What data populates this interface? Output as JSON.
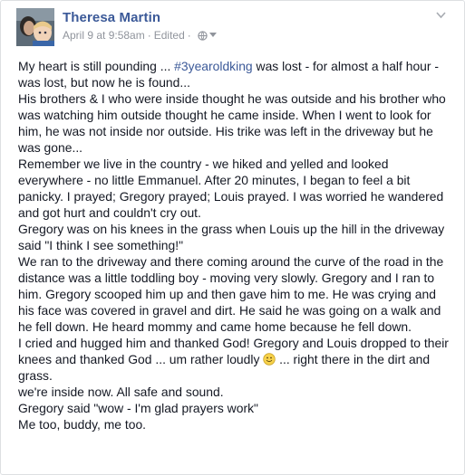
{
  "post": {
    "author_name": "Theresa Martin",
    "timestamp": "April 9 at 9:58am",
    "edited_label": "Edited",
    "separator": "·",
    "privacy_icon": "globe-icon",
    "options_icon": "chevron-down-icon",
    "paragraphs": [
      {
        "before": "My heart is still pounding ... ",
        "hashtag": "#3yearoldking",
        "after": " was lost - for almost a half hour - was lost, but now he is found..."
      },
      {
        "text": "His brothers & I who were inside thought he was outside and his brother who was watching him outside thought he came inside. When I went to look for him, he was not inside nor outside. His trike was left in the driveway but he was gone..."
      },
      {
        "text": "Remember we live in the country - we hiked and yelled and looked everywhere - no little Emmanuel. After 20 minutes, I began to feel a bit panicky. I prayed; Gregory prayed; Louis prayed. I was worried he wandered and got hurt and couldn't cry out."
      },
      {
        "text": "Gregory was on his knees in the grass when Louis up the hill in the driveway said \"I think I see something!\""
      },
      {
        "text": "We ran to the driveway and there coming around the curve of the road in the distance was a little toddling boy - moving very slowly. Gregory and I ran to him. Gregory scooped him up and then gave him to me. He was crying and his face was covered in gravel and dirt. He said he was going on a walk and he fell down. He heard mommy and came home because he fell down."
      },
      {
        "before": "I cried and hugged him and thanked God! Gregory and Louis dropped to their knees and thanked God ... um rather loudly ",
        "emoji": "smiley-icon",
        "after": " ... right there in the dirt and grass."
      },
      {
        "text": "we're inside now. All safe and sound."
      },
      {
        "text": "Gregory said \"wow - I'm glad prayers work\""
      },
      {
        "text": "Me too, buddy, me too."
      }
    ]
  },
  "colors": {
    "author_link": "#3b5998",
    "meta_text": "#90949c",
    "body_text": "#141823",
    "border": "#dddfe2"
  }
}
